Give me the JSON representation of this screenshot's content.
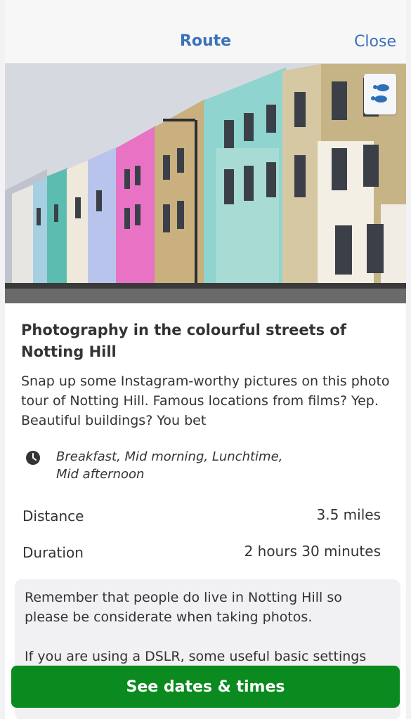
{
  "header": {
    "title": "Route",
    "close_label": "Close"
  },
  "hero": {
    "badge_icon": "walking-footprints-icon"
  },
  "route": {
    "title": "Photography in the colourful streets of Notting Hill",
    "description": "Snap up some Instagram-worthy pictures on this photo tour of Notting Hill. Famous locations from films? Yep. Beautiful buildings? You bet",
    "times_line1": "Breakfast, Mid morning, Lunchtime,",
    "times_line2": "Mid afternoon",
    "distance_label": "Distance",
    "distance_value": "3.5 miles",
    "duration_label": "Duration",
    "duration_value": "2 hours 30 minutes"
  },
  "note": {
    "paragraph1": "Remember that people do live in Notting Hill so please be considerate when taking photos.",
    "paragraph2": "If you are using a DSLR, some useful basic settings"
  },
  "cta": {
    "label": "See dates & times"
  },
  "colors": {
    "accent": "#3a72b8",
    "cta": "#0a8a1f"
  }
}
